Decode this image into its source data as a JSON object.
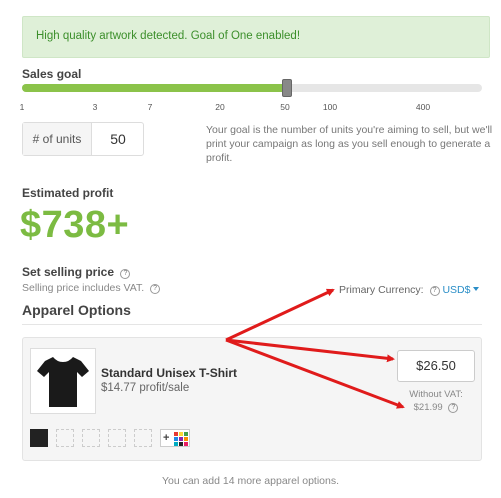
{
  "banner": {
    "message": "High quality artwork detected. Goal of One enabled!"
  },
  "sales_goal": {
    "label": "Sales goal",
    "ticks": [
      "1",
      "3",
      "7",
      "20",
      "50",
      "100",
      "400"
    ],
    "selected_fraction": 0.575,
    "units_label": "# of units",
    "units_value": "50",
    "help_text": "Your goal is the number of units you're aiming to sell, but we'll print your campaign as long as you sell enough to generate a profit."
  },
  "estimated_profit": {
    "label": "Estimated profit",
    "value": "$738+"
  },
  "selling_price": {
    "label": "Set selling price",
    "vat_note": "Selling price includes VAT.",
    "primary_currency_label": "Primary Currency:",
    "currency": "USD$"
  },
  "apparel": {
    "heading": "Apparel Options",
    "product": {
      "name": "Standard Unisex T-Shirt",
      "profit": "$14.77 profit/sale",
      "price": "$26.50",
      "without_vat_label": "Without VAT:",
      "without_vat_price": "$21.99"
    },
    "add_color_icon": "plus-palette-icon",
    "footer_note": "You can add 14 more apparel options."
  },
  "colors": {
    "accent_green": "#7cbb42",
    "banner_bg": "#dff0d8",
    "link_blue": "#2a8ec7",
    "arrow_red": "#e01b1b"
  }
}
